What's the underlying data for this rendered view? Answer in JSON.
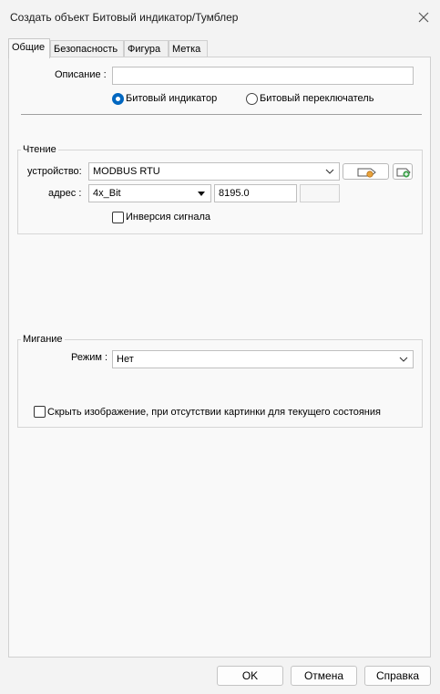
{
  "window": {
    "title": "Создать объект Битовый индикатор/Тумблер"
  },
  "tabs": [
    {
      "label": "Общие"
    },
    {
      "label": "Безопасность"
    },
    {
      "label": "Фигура"
    },
    {
      "label": "Метка"
    }
  ],
  "general": {
    "description_label": "Описание :",
    "description_value": "",
    "radio_indicator": "Битовый индикатор",
    "radio_switch": "Битовый переключатель",
    "selected_mode": "indicator"
  },
  "read": {
    "group_title": "Чтение",
    "device_label": "устройство:",
    "device_value": "MODBUS RTU",
    "address_label": "адрес :",
    "address_type": "4x_Bit",
    "address_value": "8195.0",
    "address_extra": "",
    "invert_label": "Инверсия сигнала",
    "invert_checked": false
  },
  "blink": {
    "group_title": "Мигание",
    "mode_label": "Режим :",
    "mode_value": "Нет"
  },
  "hide_image": {
    "label": "Скрыть изображение, при отсутствии картинки для текущего состояния",
    "checked": false
  },
  "footer": {
    "ok": "OK",
    "cancel": "Отмена",
    "help": "Справка"
  },
  "colors": {
    "accent": "#0067c0",
    "window_bg": "#f3f3f3",
    "panel_bg": "#f9f9f9"
  }
}
